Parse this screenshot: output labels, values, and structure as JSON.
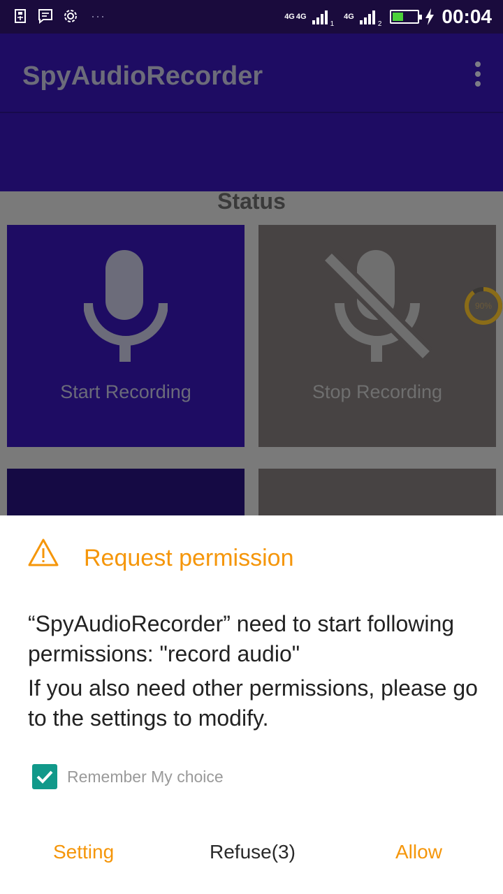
{
  "status_bar": {
    "time": "00:04",
    "network_1": "4G",
    "network_2": "4G",
    "network_3": "4G",
    "sim_1": "1",
    "sim_2": "2",
    "more": "···",
    "battery_level": 0.4,
    "icons": [
      "usb-icon",
      "message-icon",
      "settings-icon",
      "signal-icon",
      "battery-icon",
      "charging-icon"
    ]
  },
  "app_bar": {
    "title": "SpyAudioRecorder",
    "menu_icon": "more-vert-icon"
  },
  "main": {
    "status_label": "Status",
    "tiles": [
      {
        "label": "Start Recording",
        "icon": "mic-icon"
      },
      {
        "label": "Stop Recording",
        "icon": "mic-off-icon"
      }
    ],
    "progress_value": 0.9,
    "progress_text": "90%"
  },
  "dialog": {
    "title": "Request permission",
    "icon": "warning-icon",
    "message_line1": "“SpyAudioRecorder” need to start following permissions:  \"record audio\"",
    "message_line2": "If you also need other permissions, please go to the settings to modify.",
    "remember_label": "Remember My choice",
    "remember_checked": true,
    "buttons": {
      "setting": "Setting",
      "refuse": "Refuse(3)",
      "allow": "Allow"
    }
  },
  "colors": {
    "accent": "#f5960a",
    "checkbox": "#11998a",
    "app_bar": "#1e0c63"
  }
}
